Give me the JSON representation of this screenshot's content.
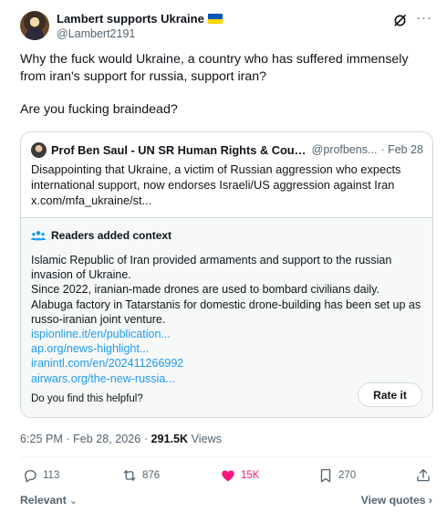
{
  "author": {
    "name": "Lambert supports Ukraine",
    "handle": "@Lambert2191"
  },
  "tweet": {
    "line1": "Why the fuck would Ukraine, a country who has suffered immensely",
    "line2": "from iran's support for russia, support iran?",
    "line3": "Are you fucking braindead?"
  },
  "quote": {
    "name": "Prof Ben Saul - UN SR Human Rights & Countert...",
    "handle": "@profbens...",
    "date": "· Feb 28",
    "text_line1": "Disappointing that Ukraine, a victim of Russian aggression who expects",
    "text_line2": "international support, now endorses Israeli/US aggression against Iran",
    "text_line3": "x.com/mfa_ukraine/st..."
  },
  "notes": {
    "title": "Readers added context",
    "line1": "Islamic Republic of Iran provided armaments and support to the russian",
    "line2": "invasion of Ukraine.",
    "line3": "Since 2022, iranian-made drones are used to bombard civilians daily.",
    "line4": "Alabuga factory in Tatarstanis for domestic drone-building has been set up as",
    "line5": "russo-iranian joint venture.",
    "links": [
      "ispionline.it/en/publication...",
      "ap.org/news-highlight...",
      "iranintl.com/en/202411266992",
      "airwars.org/the-new-russia..."
    ],
    "helpful_question": "Do you find this helpful?",
    "rate_label": "Rate it"
  },
  "meta": {
    "time": "6:25 PM · Feb 28, 2026 · ",
    "views_count": "291.5K",
    "views_label": " Views"
  },
  "actions": {
    "replies": "113",
    "reposts": "876",
    "likes": "15K",
    "bookmarks": "270"
  },
  "bottom": {
    "relevant_label": "Relevant",
    "view_quotes_label": "View quotes"
  },
  "colors": {
    "accent": "#1d9bf0",
    "like": "#f91880",
    "secondary_text": "#536471"
  }
}
